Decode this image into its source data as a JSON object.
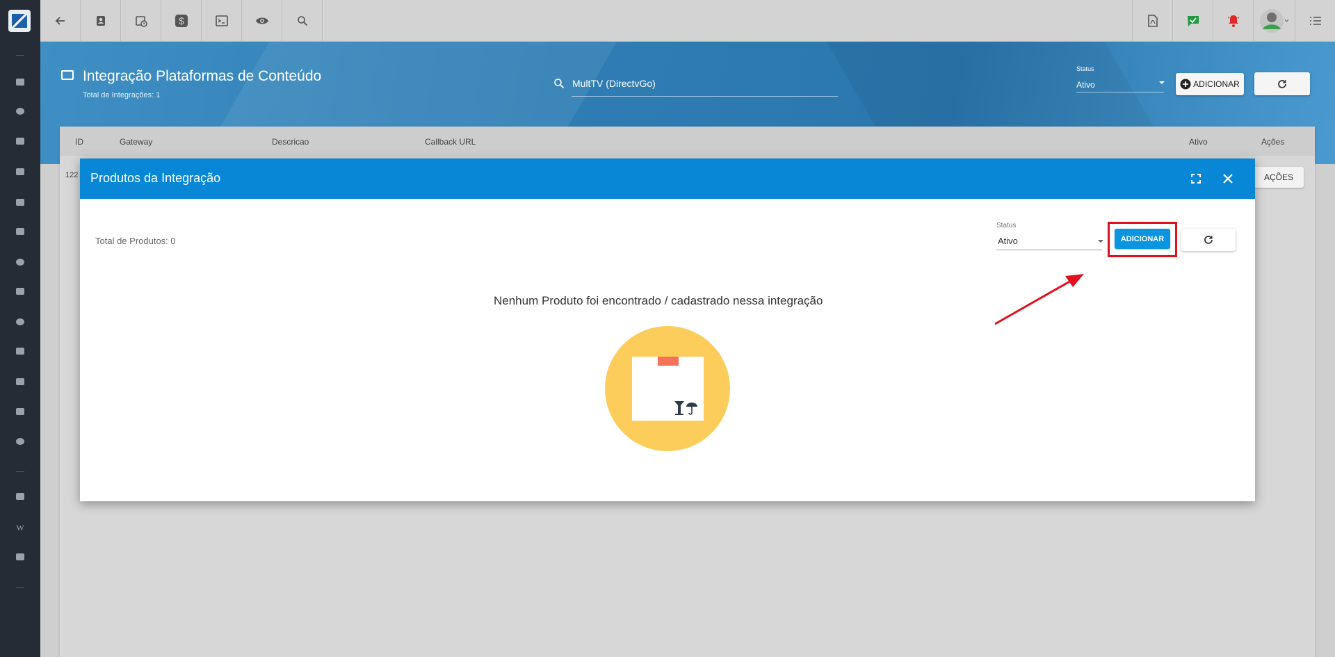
{
  "page": {
    "title": "Integração Plataformas de Conteúdo",
    "subtitle": "Total de Integrações: 1",
    "search_value": "MultTV (DirectvGo)",
    "status_label": "Status",
    "status_value": "Ativo",
    "add_label": "ADICIONAR"
  },
  "table": {
    "columns": [
      "ID",
      "Gateway",
      "Descricao",
      "Callback URL",
      "Ativo",
      "Ações"
    ],
    "row_id": "122",
    "actions_label": "AÇÕES"
  },
  "modal": {
    "title": "Produtos da Integração",
    "total": "Total de Produtos: 0",
    "status_label": "Status",
    "status_value": "Ativo",
    "add_label": "ADICIONAR",
    "empty_message": "Nenhum Produto foi encontrado / cadastrado nessa integração"
  },
  "colors": {
    "modal_header": "#0787d6",
    "highlight": "#e0101e",
    "illustration_circle": "#fccd5b"
  }
}
